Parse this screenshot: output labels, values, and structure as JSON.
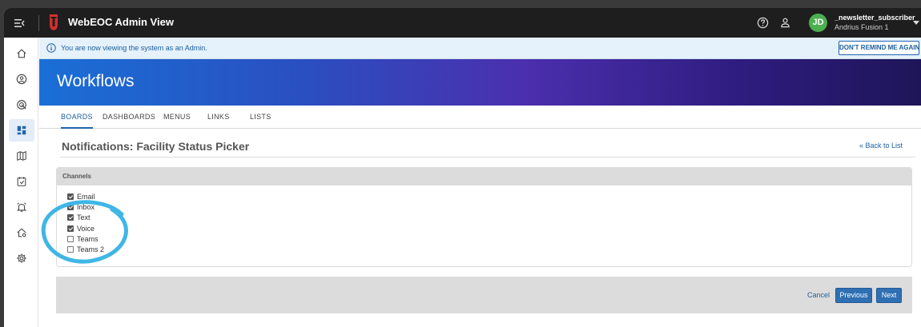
{
  "app": {
    "title": "WebEOC Admin View"
  },
  "user": {
    "initials": "JD",
    "name": "_newsletter_subscriber",
    "org": "Andrius Fusion 1"
  },
  "banner": {
    "text": "You are now viewing the system as an Admin.",
    "dismiss_label": "DON'T REMIND ME AGAIN"
  },
  "hero": {
    "title": "Workflows"
  },
  "tabs": [
    {
      "label": "BOARDS",
      "active": true
    },
    {
      "label": "DASHBOARDS",
      "active": false
    },
    {
      "label": "MENUS",
      "active": false
    },
    {
      "label": "LINKS",
      "active": false
    },
    {
      "label": "LISTS",
      "active": false
    }
  ],
  "page": {
    "title": "Notifications: Facility Status Picker",
    "back_label": "« Back to List"
  },
  "channels": {
    "title": "Channels",
    "items": [
      {
        "label": "Email",
        "checked": true
      },
      {
        "label": "Inbox",
        "checked": true
      },
      {
        "label": "Text",
        "checked": true
      },
      {
        "label": "Voice",
        "checked": true
      },
      {
        "label": "Teams",
        "checked": false
      },
      {
        "label": "Teams 2",
        "checked": false
      }
    ]
  },
  "footer": {
    "cancel_label": "Cancel",
    "previous_label": "Previous",
    "next_label": "Next"
  },
  "nav": [
    "home-icon",
    "user-circle-icon",
    "target-icon",
    "dashboard-icon",
    "map-icon",
    "calendar-icon",
    "alarm-icon",
    "home-settings-icon",
    "gear-icon"
  ],
  "colors": {
    "accent": "#1f64b0",
    "avatar": "#4caf50",
    "annotation": "#3fb6e6"
  }
}
